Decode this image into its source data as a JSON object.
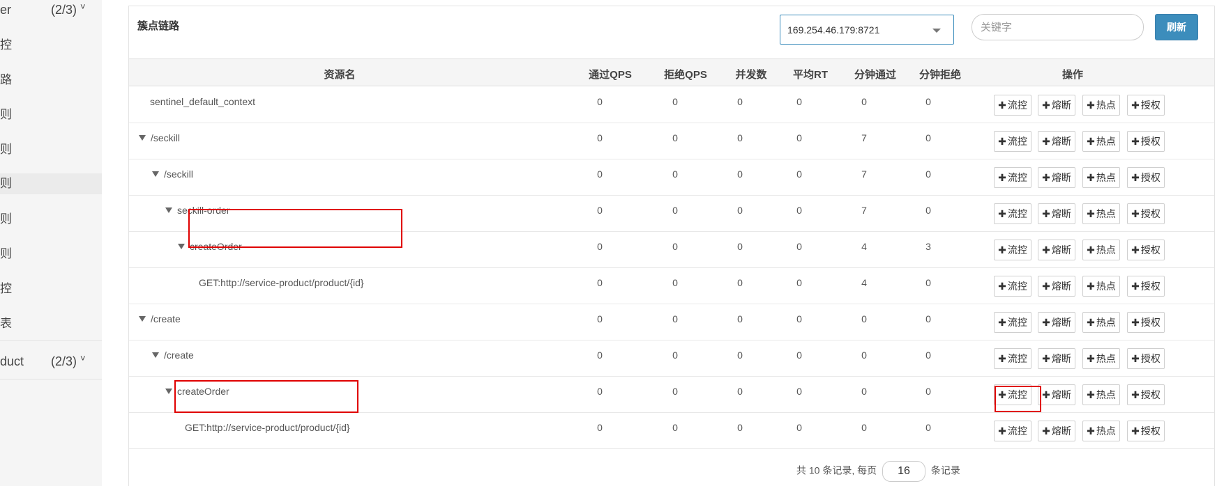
{
  "sidebar": {
    "groups": [
      {
        "name": "er",
        "count": "(2/3)",
        "chevron": "˅"
      },
      {
        "name": "duct",
        "count": "(2/3)",
        "chevron": "˅"
      }
    ],
    "items": [
      {
        "label": "控"
      },
      {
        "label": "路"
      },
      {
        "label": "则"
      },
      {
        "label": "则"
      },
      {
        "label": "则"
      },
      {
        "label": "则"
      },
      {
        "label": "则"
      },
      {
        "label": "控"
      },
      {
        "label": "表"
      }
    ]
  },
  "panel": {
    "title": "簇点链路",
    "machine": "169.254.46.179:8721",
    "keyword_placeholder": "关键字",
    "refresh_label": "刷新"
  },
  "table": {
    "headers": [
      "资源名",
      "通过QPS",
      "拒绝QPS",
      "并发数",
      "平均RT",
      "分钟通过",
      "分钟拒绝",
      "操作"
    ],
    "rows": [
      {
        "name": "sentinel_default_context",
        "caret": false,
        "pass_qps": "0",
        "block_qps": "0",
        "threads": "0",
        "avg_rt": "0",
        "min_pass": "0",
        "min_block": "0"
      },
      {
        "name": "/seckill",
        "caret": true,
        "pass_qps": "0",
        "block_qps": "0",
        "threads": "0",
        "avg_rt": "0",
        "min_pass": "7",
        "min_block": "0"
      },
      {
        "name": "/seckill",
        "caret": true,
        "pass_qps": "0",
        "block_qps": "0",
        "threads": "0",
        "avg_rt": "0",
        "min_pass": "7",
        "min_block": "0"
      },
      {
        "name": "seckill-order",
        "caret": true,
        "pass_qps": "0",
        "block_qps": "0",
        "threads": "0",
        "avg_rt": "0",
        "min_pass": "7",
        "min_block": "0"
      },
      {
        "name": "createOrder",
        "caret": true,
        "pass_qps": "0",
        "block_qps": "0",
        "threads": "0",
        "avg_rt": "0",
        "min_pass": "4",
        "min_block": "3"
      },
      {
        "name": "GET:http://service-product/product/{id}",
        "caret": false,
        "pass_qps": "0",
        "block_qps": "0",
        "threads": "0",
        "avg_rt": "0",
        "min_pass": "4",
        "min_block": "0"
      },
      {
        "name": "/create",
        "caret": true,
        "pass_qps": "0",
        "block_qps": "0",
        "threads": "0",
        "avg_rt": "0",
        "min_pass": "0",
        "min_block": "0"
      },
      {
        "name": "/create",
        "caret": true,
        "pass_qps": "0",
        "block_qps": "0",
        "threads": "0",
        "avg_rt": "0",
        "min_pass": "0",
        "min_block": "0"
      },
      {
        "name": "createOrder",
        "caret": true,
        "pass_qps": "0",
        "block_qps": "0",
        "threads": "0",
        "avg_rt": "0",
        "min_pass": "0",
        "min_block": "0"
      },
      {
        "name": "GET:http://service-product/product/{id}",
        "caret": false,
        "pass_qps": "0",
        "block_qps": "0",
        "threads": "0",
        "avg_rt": "0",
        "min_pass": "0",
        "min_block": "0"
      }
    ],
    "actions": [
      "流控",
      "熔断",
      "热点",
      "授权"
    ]
  },
  "pager": {
    "prefix": "共 10 条记录, 每页",
    "page_size": "16",
    "suffix": "条记录"
  },
  "colors": {
    "primary": "#3c8dbc",
    "highlight": "#e00000"
  }
}
